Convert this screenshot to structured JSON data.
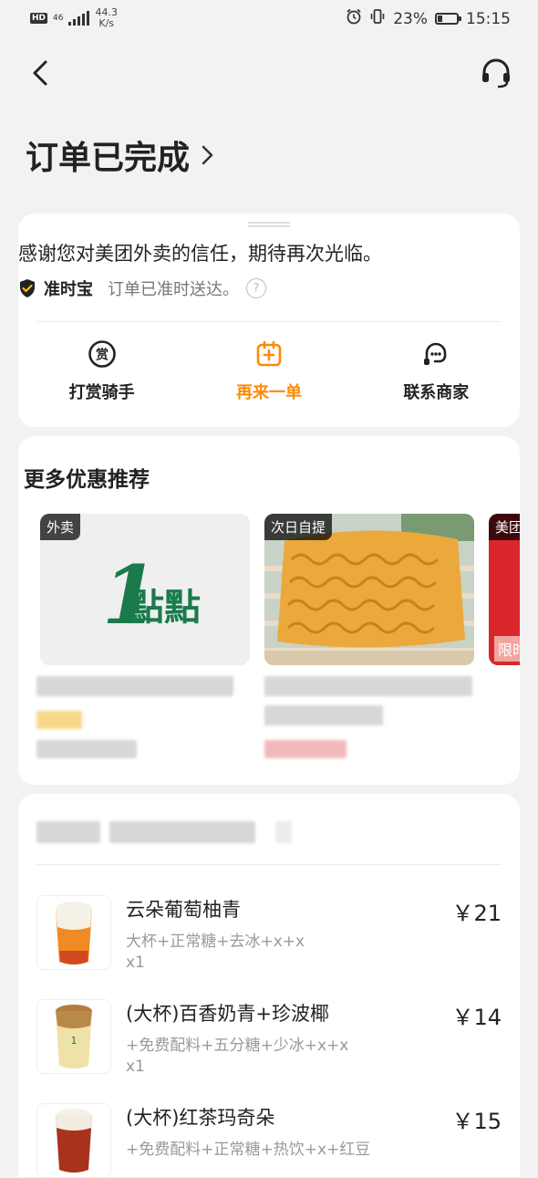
{
  "status_bar": {
    "hd": "HD",
    "network": "46",
    "speed_value": "44.3",
    "speed_unit": "K/s",
    "battery": "23%",
    "time": "15:15"
  },
  "header": {
    "title": "订单已完成"
  },
  "status_card": {
    "thanks": "感谢您对美团外卖的信任，期待再次光临。",
    "ontime_label": "准时宝",
    "ontime_desc": "订单已准时送达。",
    "help_glyph": "?",
    "actions": [
      {
        "label": "打赏骑手",
        "icon": "reward-icon",
        "icon_text": "赏"
      },
      {
        "label": "再来一单",
        "icon": "reorder-icon"
      },
      {
        "label": "联系商家",
        "icon": "chat-icon"
      }
    ]
  },
  "promotions": {
    "title": "更多优惠推荐",
    "items": [
      {
        "tag": "外卖",
        "logo_digit": "1",
        "logo_text": "點點"
      },
      {
        "tag": "次日自提"
      },
      {
        "tag": "美团",
        "badge": "限时"
      }
    ]
  },
  "order_items": [
    {
      "name": "云朵葡萄柚青",
      "spec": "大杯+正常糖+去冰+x+x",
      "qty": "x1",
      "price": "￥21"
    },
    {
      "name": "(大杯)百香奶青+珍波椰",
      "spec": "+免费配料+五分糖+少冰+x+x",
      "qty": "x1",
      "price": "￥14"
    },
    {
      "name": "(大杯)红茶玛奇朵",
      "spec": "+免费配料+正常糖+热饮+x+红豆",
      "qty": "x1",
      "price": "￥15"
    }
  ],
  "colors": {
    "accent": "#ff8a00",
    "brand_green": "#1a7a4c",
    "background": "#f2f2f2"
  }
}
